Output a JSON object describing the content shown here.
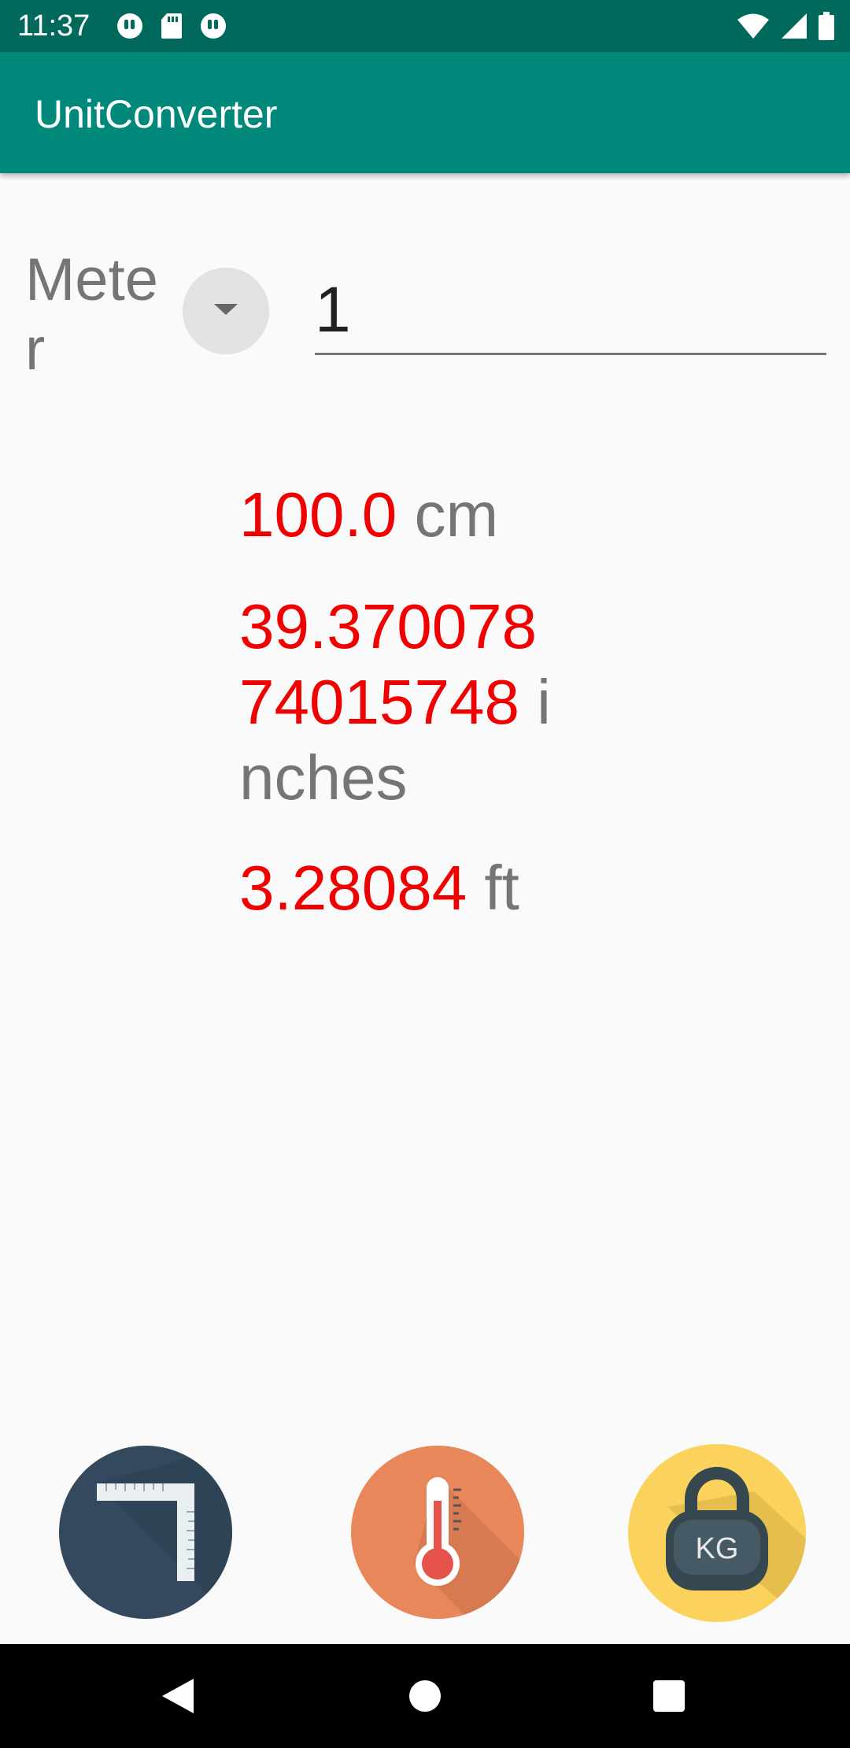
{
  "status_bar": {
    "time": "11:37",
    "left_icons": [
      "notification-app-icon",
      "sd-card-icon",
      "notification-app-icon"
    ],
    "right_icons": [
      "wifi-icon",
      "signal-icon",
      "battery-icon"
    ]
  },
  "app_bar": {
    "title": "UnitConverter",
    "color": "#00897b"
  },
  "converter": {
    "unit_selected": "Meter",
    "input_value": "1"
  },
  "results": [
    {
      "value": "100.0",
      "unit": "cm"
    },
    {
      "value": "39.37007874015748",
      "unit": "inches"
    },
    {
      "value": "3.28084",
      "unit": "ft"
    }
  ],
  "categories": [
    {
      "name": "length",
      "icon": "ruler-icon",
      "color": "#34495e"
    },
    {
      "name": "temperature",
      "icon": "thermometer-icon",
      "color": "#e8885a"
    },
    {
      "name": "weight",
      "icon": "kettlebell-icon",
      "label": "KG",
      "color": "#fbd35c"
    }
  ],
  "colors": {
    "value_red": "#f00000",
    "unit_grey": "#757575",
    "status_bar": "#00695c"
  }
}
